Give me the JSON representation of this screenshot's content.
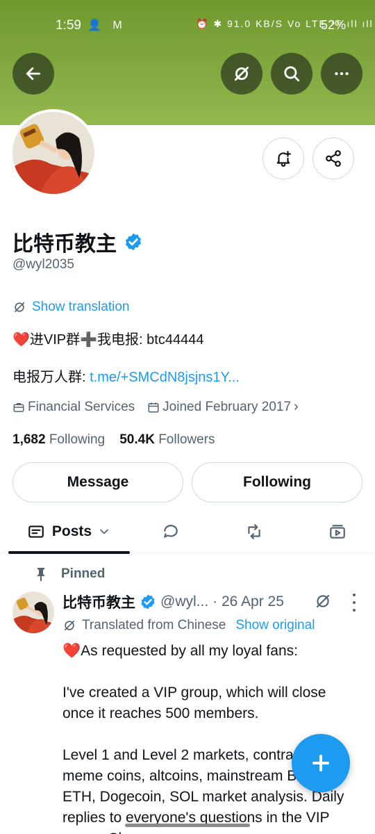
{
  "status_bar": {
    "time": "1:59",
    "left_icons": "👤 M",
    "right_icons": "⏰ ✱ 91.0 KB/S Vo LTE ⁴ᴳ ıll ıll",
    "battery": "52%"
  },
  "profile": {
    "display_name": "比特币教主",
    "handle": "@wyl2035",
    "show_translation": "Show translation",
    "bio_line1": "❤️进VIP群➕我电报: btc44444",
    "bio_line2_prefix": "电报万人群: ",
    "bio_line2_link": "t.me/+SMCdN8jsjns1Y...",
    "category": "Financial Services",
    "joined": "Joined February 2017",
    "following_count": "1,682",
    "following_label": "Following",
    "followers_count": "50.4K",
    "followers_label": "Followers"
  },
  "actions": {
    "message": "Message",
    "following": "Following"
  },
  "tabs": {
    "posts": "Posts"
  },
  "pinned_post": {
    "pinned_label": "Pinned",
    "author": "比特币教主",
    "handle": "@wyl...",
    "date": "· 26 Apr 25",
    "translated_note": "Translated from Chinese",
    "show_original": "Show original",
    "line1": "❤️As requested by all my loyal fans:",
    "line2": "I've created a VIP group, which will close once it reaches 500 members.",
    "line3": "Level 1 and Level 2 markets, contracts, meme coins, altcoins, mainstream BTC, ETH, Dogecoin, SOL market analysis. Daily replies to everyone's questions in the VIP group. Chan"
  },
  "colors": {
    "accent": "#1d9bf0",
    "banner": "#7ea63c",
    "secondary_text": "#536471"
  }
}
